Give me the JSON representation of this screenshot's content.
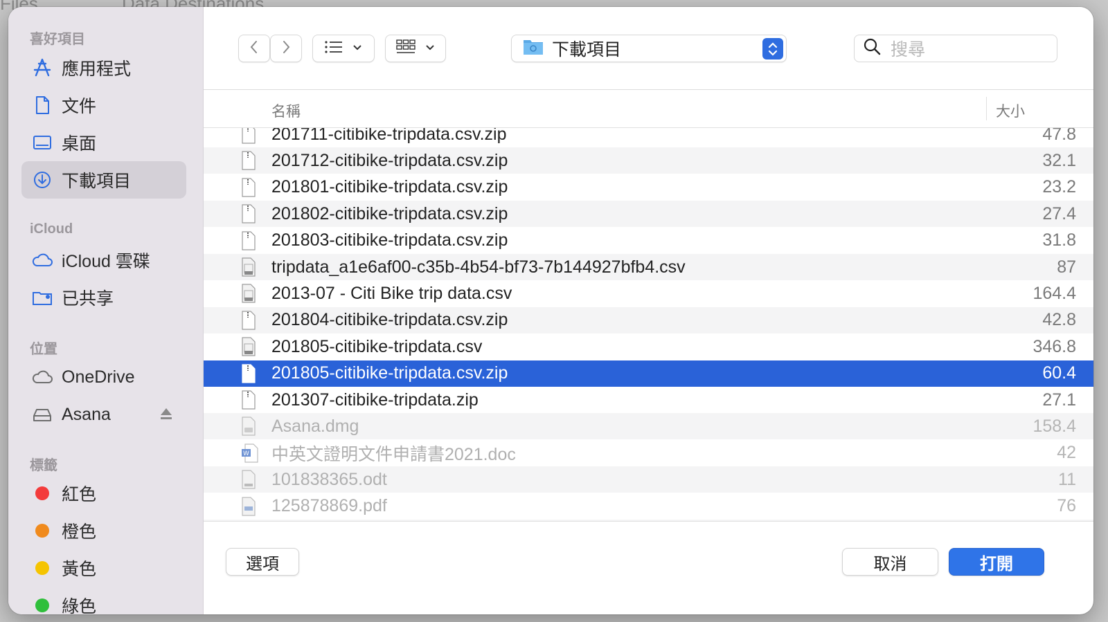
{
  "background": {
    "title_left": "Files",
    "title_right": "Data Destinations"
  },
  "sidebar": {
    "sections": {
      "favorites": "喜好項目",
      "icloud": "iCloud",
      "locations": "位置",
      "tags": "標籤"
    },
    "favorites": [
      {
        "label": "應用程式",
        "icon": "applications-icon"
      },
      {
        "label": "文件",
        "icon": "document-icon"
      },
      {
        "label": "桌面",
        "icon": "desktop-icon"
      },
      {
        "label": "下載項目",
        "icon": "downloads-icon",
        "selected": true
      }
    ],
    "icloud": [
      {
        "label": "iCloud 雲碟",
        "icon": "icloud-icon"
      },
      {
        "label": "已共享",
        "icon": "shared-folder-icon"
      }
    ],
    "locations": [
      {
        "label": "OneDrive",
        "icon": "cloud-icon"
      },
      {
        "label": "Asana",
        "icon": "disk-icon",
        "eject": true
      }
    ],
    "tags": [
      {
        "label": "紅色",
        "color": "#f33b3b"
      },
      {
        "label": "橙色",
        "color": "#f08a1d"
      },
      {
        "label": "黃色",
        "color": "#f5c400"
      },
      {
        "label": "綠色",
        "color": "#2fbf3b"
      }
    ]
  },
  "toolbar": {
    "location": "下載項目",
    "search_placeholder": "搜尋"
  },
  "list": {
    "columns": {
      "name": "名稱",
      "size": "大小"
    },
    "rows": [
      {
        "name": "201711-citibike-tripdata.csv.zip",
        "size": "47.8",
        "type": "zip",
        "state": "normal"
      },
      {
        "name": "201712-citibike-tripdata.csv.zip",
        "size": "32.1",
        "type": "zip",
        "state": "normal"
      },
      {
        "name": "201801-citibike-tripdata.csv.zip",
        "size": "23.2",
        "type": "zip",
        "state": "normal"
      },
      {
        "name": "201802-citibike-tripdata.csv.zip",
        "size": "27.4",
        "type": "zip",
        "state": "normal"
      },
      {
        "name": "201803-citibike-tripdata.csv.zip",
        "size": "31.8",
        "type": "zip",
        "state": "normal"
      },
      {
        "name": "tripdata_a1e6af00-c35b-4b54-bf73-7b144927bfb4.csv",
        "size": "87",
        "type": "csv",
        "state": "normal"
      },
      {
        "name": "2013-07 - Citi Bike trip data.csv",
        "size": "164.4",
        "type": "csv",
        "state": "normal"
      },
      {
        "name": "201804-citibike-tripdata.csv.zip",
        "size": "42.8",
        "type": "zip",
        "state": "normal"
      },
      {
        "name": "201805-citibike-tripdata.csv",
        "size": "346.8",
        "type": "csv",
        "state": "normal"
      },
      {
        "name": "201805-citibike-tripdata.csv.zip",
        "size": "60.4",
        "type": "zip",
        "state": "selected"
      },
      {
        "name": "201307-citibike-tripdata.zip",
        "size": "27.1",
        "type": "zip",
        "state": "normal"
      },
      {
        "name": "Asana.dmg",
        "size": "158.4",
        "type": "dmg",
        "state": "dim"
      },
      {
        "name": "中英文證明文件申請書2021.doc",
        "size": "42",
        "type": "doc",
        "state": "dim"
      },
      {
        "name": "101838365.odt",
        "size": "11",
        "type": "odt",
        "state": "dim"
      },
      {
        "name": "125878869.pdf",
        "size": "76",
        "type": "pdf",
        "state": "dim"
      },
      {
        "name": "",
        "size": "",
        "type": "generic",
        "state": "dim"
      }
    ]
  },
  "footer": {
    "options": "選項",
    "cancel": "取消",
    "open": "打開"
  }
}
